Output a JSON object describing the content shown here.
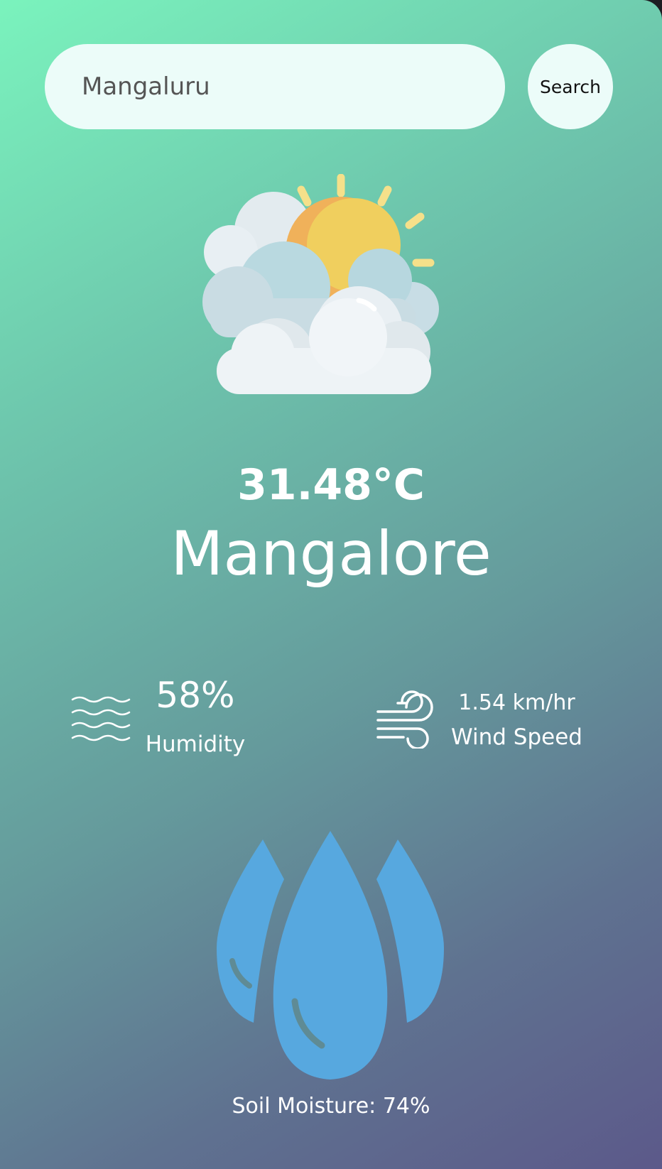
{
  "search": {
    "value": "Mangaluru",
    "button_label": "Search"
  },
  "weather": {
    "icon": "partly-cloudy-sun-icon",
    "temperature": "31.48°C",
    "city": "Mangalore"
  },
  "humidity": {
    "icon": "humidity-waves-icon",
    "value": "58%",
    "label": "Humidity"
  },
  "wind": {
    "icon": "wind-icon",
    "value": "1.54 km/hr",
    "label": "Wind Speed"
  },
  "soil": {
    "icon": "water-drops-icon",
    "text": "Soil Moisture: 74%"
  },
  "colors": {
    "gradient_start": "#7af3bd",
    "gradient_end": "#5c598a",
    "search_bg": "#ecfcf9",
    "drop_blue": "#57a8df",
    "sun": "#f0cc5a"
  }
}
